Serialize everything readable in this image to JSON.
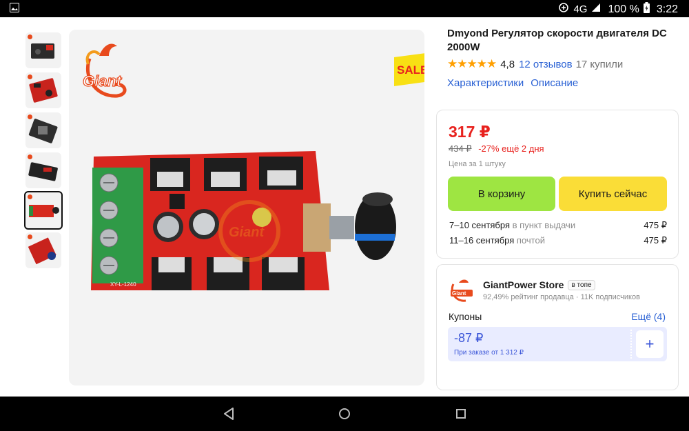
{
  "status_bar": {
    "network": "4G",
    "battery": "100 %",
    "time": "3:22"
  },
  "gallery": {
    "logo_text": "Giant",
    "sale_label": "SALE",
    "board_label": "XY-L-1240",
    "watermark": "Giant"
  },
  "product": {
    "title": "Dmyond Регулятор скорости двигателя DC 2000W",
    "stars": "★★★★★",
    "rating": "4,8",
    "reviews": "12 отзывов",
    "bought": "17 купили",
    "tabs": [
      "Характеристики",
      "Описание"
    ]
  },
  "price_card": {
    "price": "317 ₽",
    "old_price": "434 ₽",
    "discount": "-27% ещё 2 дня",
    "per_unit": "Цена за 1 штуку",
    "cart_button": "В корзину",
    "buy_button": "Купить сейчас",
    "delivery": [
      {
        "date": "7–10 сентября",
        "method": "в пункт выдачи",
        "price": "475 ₽"
      },
      {
        "date": "11–16 сентября",
        "method": "почтой",
        "price": "475 ₽"
      }
    ]
  },
  "store": {
    "name": "GiantPower Store",
    "badge": "в топе",
    "meta": "92,49% рейтинг продавца · 11K подписчиков",
    "coupons_label": "Купоны",
    "coupons_more": "Ещё (4)",
    "coupon_amount": "-87 ₽",
    "coupon_condition": "При заказе от 1 312 ₽",
    "coupon_add": "+"
  },
  "colors": {
    "price_red": "#e8221e",
    "cart_green": "#9ee542",
    "buy_yellow": "#fadd37",
    "link_blue": "#2a61d4"
  }
}
